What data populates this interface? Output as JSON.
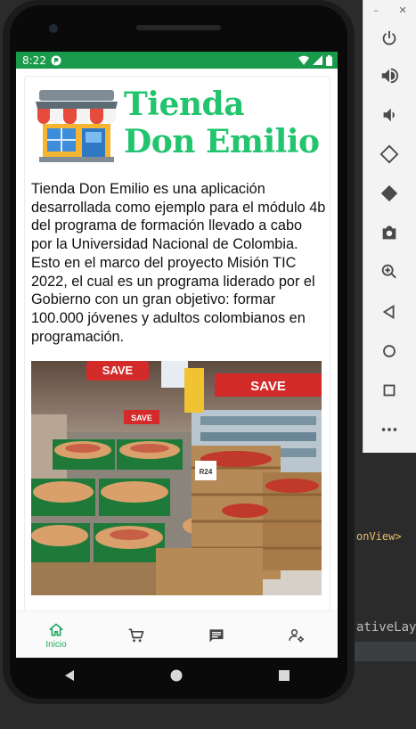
{
  "status": {
    "time": "8:22"
  },
  "app": {
    "title_line1": "Tienda",
    "title_line2": "Don Emilio",
    "description": "Tienda Don Emilio es una aplicación desarrollada como ejemplo para el módulo 4b del programa de formación llevado a cabo por la Universidad Nacional de Colombia. Esto en el marco del proyecto Misión TIC 2022, el cual es un programa liderado por el Gobierno con un gran objetivo: formar 100.000 jóvenes y adultos colombianos en programación.",
    "accent_color": "#22c46e",
    "statusbar_color": "#1a9b4b"
  },
  "photo": {
    "signs": [
      "SAVE",
      "SAVE",
      "SAVE",
      "R24"
    ]
  },
  "bottom_nav": [
    {
      "label": "Inicio",
      "icon": "home-icon",
      "active": true
    },
    {
      "label": "",
      "icon": "cart-icon",
      "active": false
    },
    {
      "label": "",
      "icon": "message-icon",
      "active": false
    },
    {
      "label": "",
      "icon": "user-settings-icon",
      "active": false
    }
  ],
  "ide": {
    "snippet1": "onView>",
    "snippet2": "ativeLayo"
  }
}
